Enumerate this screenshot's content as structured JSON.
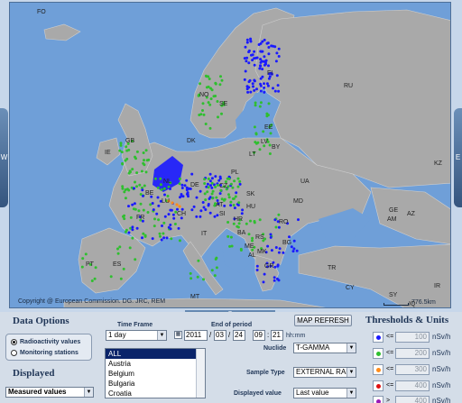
{
  "map": {
    "copyright": "Copyright @ European Commission. DG. JRC, REM",
    "scale": "776.5km",
    "left_arrow": "W",
    "right_arrow": "E",
    "bottom_arrow": "S",
    "country_labels": [
      "FO",
      "NO",
      "SE",
      "FI",
      "RU",
      "EE",
      "LV",
      "LT",
      "IE",
      "GB",
      "DK",
      "NL",
      "BE",
      "DE",
      "PL",
      "BY",
      "UA",
      "LU",
      "CZ",
      "SK",
      "FR",
      "CH",
      "AT",
      "HU",
      "MD",
      "SI",
      "HR",
      "BA",
      "RS",
      "RO",
      "IT",
      "ME",
      "AL",
      "MK",
      "BG",
      "KZ",
      "GE",
      "AM",
      "AZ",
      "ES",
      "PT",
      "GR",
      "TR",
      "SY",
      "CY",
      "IR",
      "IQ",
      "MT"
    ]
  },
  "data_options": {
    "title": "Data Options",
    "radio_measured": "Radioactivity values",
    "radio_stations": "Monitoring stations",
    "displayed_title": "Displayed",
    "displayed_value": "Measured values"
  },
  "time": {
    "time_frame_label": "Time Frame",
    "time_frame_value": "1 day",
    "end_label": "End of period",
    "year": "2011",
    "month": "03",
    "day": "24",
    "hour": "09",
    "minute": "21",
    "hhmm": "hh:mm",
    "refresh": "MAP REFRESH",
    "countries": [
      "ALL",
      "Austria",
      "Belgium",
      "Bulgaria",
      "Croatia"
    ]
  },
  "controls": {
    "nuclide_label": "Nuclide",
    "nuclide_value": "T-GAMMA",
    "sample_label": "Sample Type",
    "sample_value": "EXTERNAL RAD",
    "display_label": "Displayed value",
    "display_value": "Last value"
  },
  "thresholds": {
    "title": "Thresholds & Units",
    "rows": [
      {
        "color": "#1a1aff",
        "op": "<=",
        "value": "100",
        "unit": "nSv/h"
      },
      {
        "color": "#2fbf2f",
        "op": "<=",
        "value": "200",
        "unit": "nSv/h"
      },
      {
        "color": "#ff8c1a",
        "op": "<=",
        "value": "300",
        "unit": "nSv/h"
      },
      {
        "color": "#e01010",
        "op": "<=",
        "value": "400",
        "unit": "nSv/h"
      },
      {
        "color": "#9a1ab8",
        "op": ">",
        "value": "400",
        "unit": "nSv/h"
      }
    ]
  }
}
